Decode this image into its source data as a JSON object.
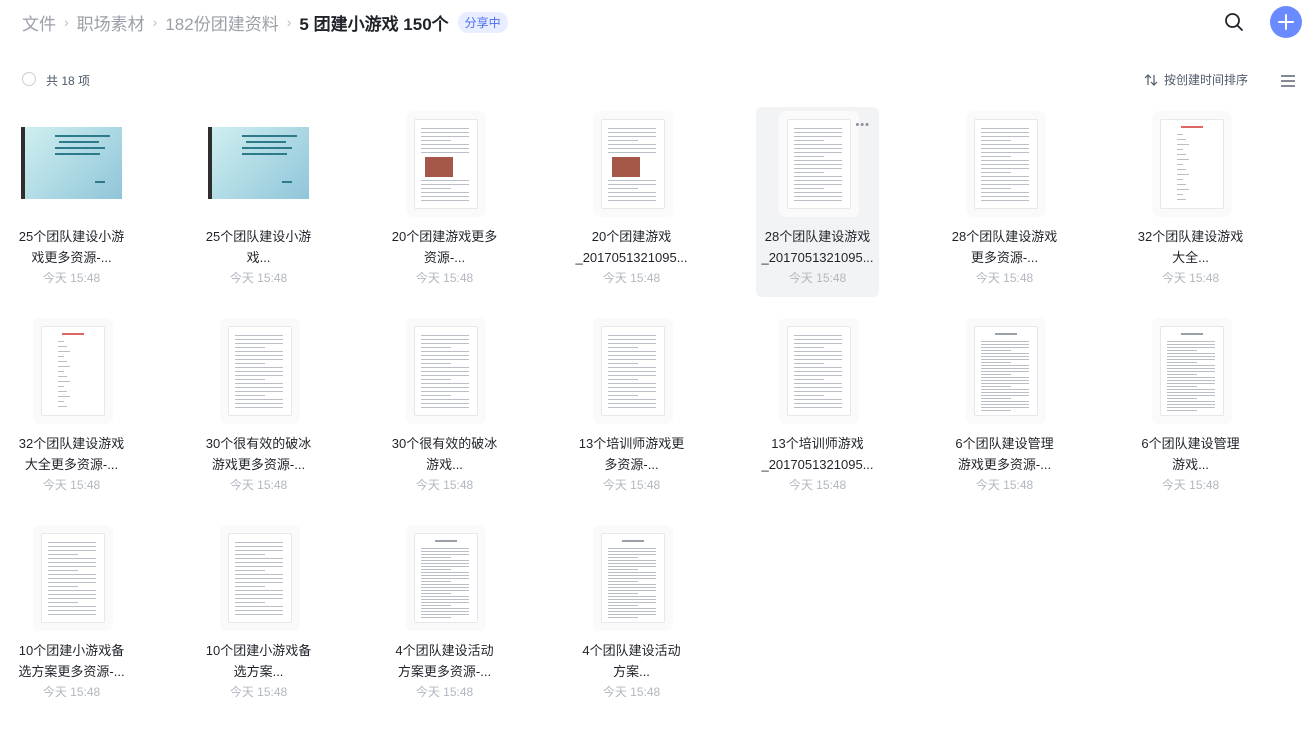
{
  "breadcrumb": {
    "items": [
      "文件",
      "职场素材",
      "182份团建资料"
    ],
    "current": "5 团建小游戏 150个",
    "badge": "分享中"
  },
  "toolbar": {
    "count": "共 18 项",
    "sort": "按创建时间排序"
  },
  "icons": {
    "search": "search-icon",
    "add": "plus-icon",
    "sort": "sort-arrows-icon",
    "view": "list-view-icon",
    "more": "more-icon"
  },
  "files": [
    {
      "line1": "25个团队建设小游",
      "line2": "戏更多资源-...",
      "time": "今天 15:48",
      "thumb": "slide"
    },
    {
      "line1": "25个团队建设小游",
      "line2": "戏...",
      "time": "今天 15:48",
      "thumb": "slide"
    },
    {
      "line1": "20个团建游戏更多",
      "line2": "资源-...",
      "time": "今天 15:48",
      "thumb": "photo"
    },
    {
      "line1": "20个团建游戏",
      "line2": "_2017051321095...",
      "time": "今天 15:48",
      "thumb": "photo"
    },
    {
      "line1": "28个团队建设游戏",
      "line2": "_2017051321095...",
      "time": "今天 15:48",
      "thumb": "doc",
      "hover": true
    },
    {
      "line1": "28个团队建设游戏",
      "line2": "更多资源-...",
      "time": "今天 15:48",
      "thumb": "doc"
    },
    {
      "line1": "32个团队建设游戏",
      "line2": "大全...",
      "time": "今天 15:48",
      "thumb": "list"
    },
    {
      "line1": "32个团队建设游戏",
      "line2": "大全更多资源-...",
      "time": "今天 15:48",
      "thumb": "list"
    },
    {
      "line1": "30个很有效的破冰",
      "line2": "游戏更多资源-...",
      "time": "今天 15:48",
      "thumb": "doc"
    },
    {
      "line1": "30个很有效的破冰",
      "line2": "游戏...",
      "time": "今天 15:48",
      "thumb": "doc"
    },
    {
      "line1": "13个培训师游戏更",
      "line2": "多资源-...",
      "time": "今天 15:48",
      "thumb": "doc"
    },
    {
      "line1": "13个培训师游戏",
      "line2": "_2017051321095...",
      "time": "今天 15:48",
      "thumb": "doc"
    },
    {
      "line1": "6个团队建设管理",
      "line2": "游戏更多资源-...",
      "time": "今天 15:48",
      "thumb": "dense"
    },
    {
      "line1": "6个团队建设管理",
      "line2": "游戏...",
      "time": "今天 15:48",
      "thumb": "dense"
    },
    {
      "line1": "10个团建小游戏备",
      "line2": "选方案更多资源-...",
      "time": "今天 15:48",
      "thumb": "doc"
    },
    {
      "line1": "10个团建小游戏备",
      "line2": "选方案...",
      "time": "今天 15:48",
      "thumb": "doc"
    },
    {
      "line1": "4个团队建设活动",
      "line2": "方案更多资源-...",
      "time": "今天 15:48",
      "thumb": "dense"
    },
    {
      "line1": "4个团队建设活动",
      "line2": "方案...",
      "time": "今天 15:48",
      "thumb": "dense"
    }
  ]
}
